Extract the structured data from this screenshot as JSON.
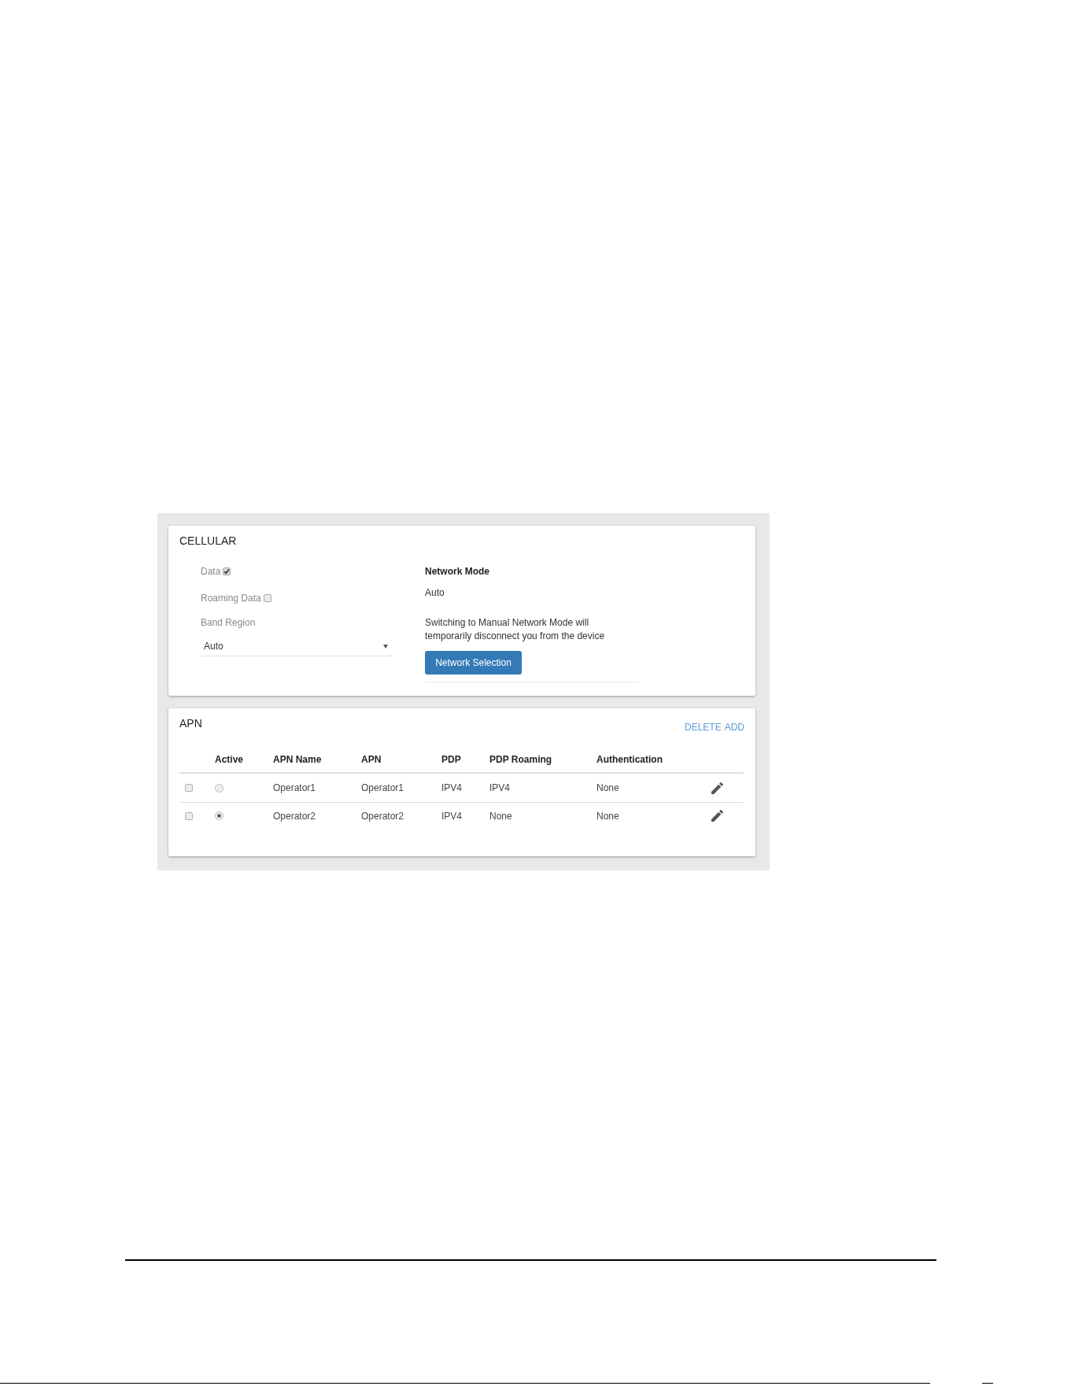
{
  "cellular": {
    "title": "CELLULAR",
    "toggles": [
      {
        "label": "Data",
        "checked": true
      },
      {
        "label": "Roaming Data",
        "checked": false
      }
    ],
    "band_region": {
      "label": "Band Region",
      "value": "Auto"
    },
    "network_mode": {
      "label": "Network Mode",
      "value": "Auto",
      "note": "Switching to Manual Network Mode will temporarily disconnect you from the device",
      "button": "Network Selection"
    }
  },
  "apn": {
    "title": "APN",
    "actions": [
      "DELETE",
      "ADD"
    ],
    "table": {
      "columns": [
        "Active",
        "APN Name",
        "APN",
        "PDP",
        "PDP Roaming",
        "Authentication"
      ],
      "rows": [
        {
          "checked": false,
          "selected": false,
          "cells": [
            "",
            "Operator1",
            "Operator1",
            "IPV4",
            "IPV4",
            "None"
          ]
        },
        {
          "checked": false,
          "selected": true,
          "cells": [
            "",
            "Operator2",
            "Operator2",
            "IPV4",
            "None",
            "None"
          ]
        }
      ]
    }
  }
}
